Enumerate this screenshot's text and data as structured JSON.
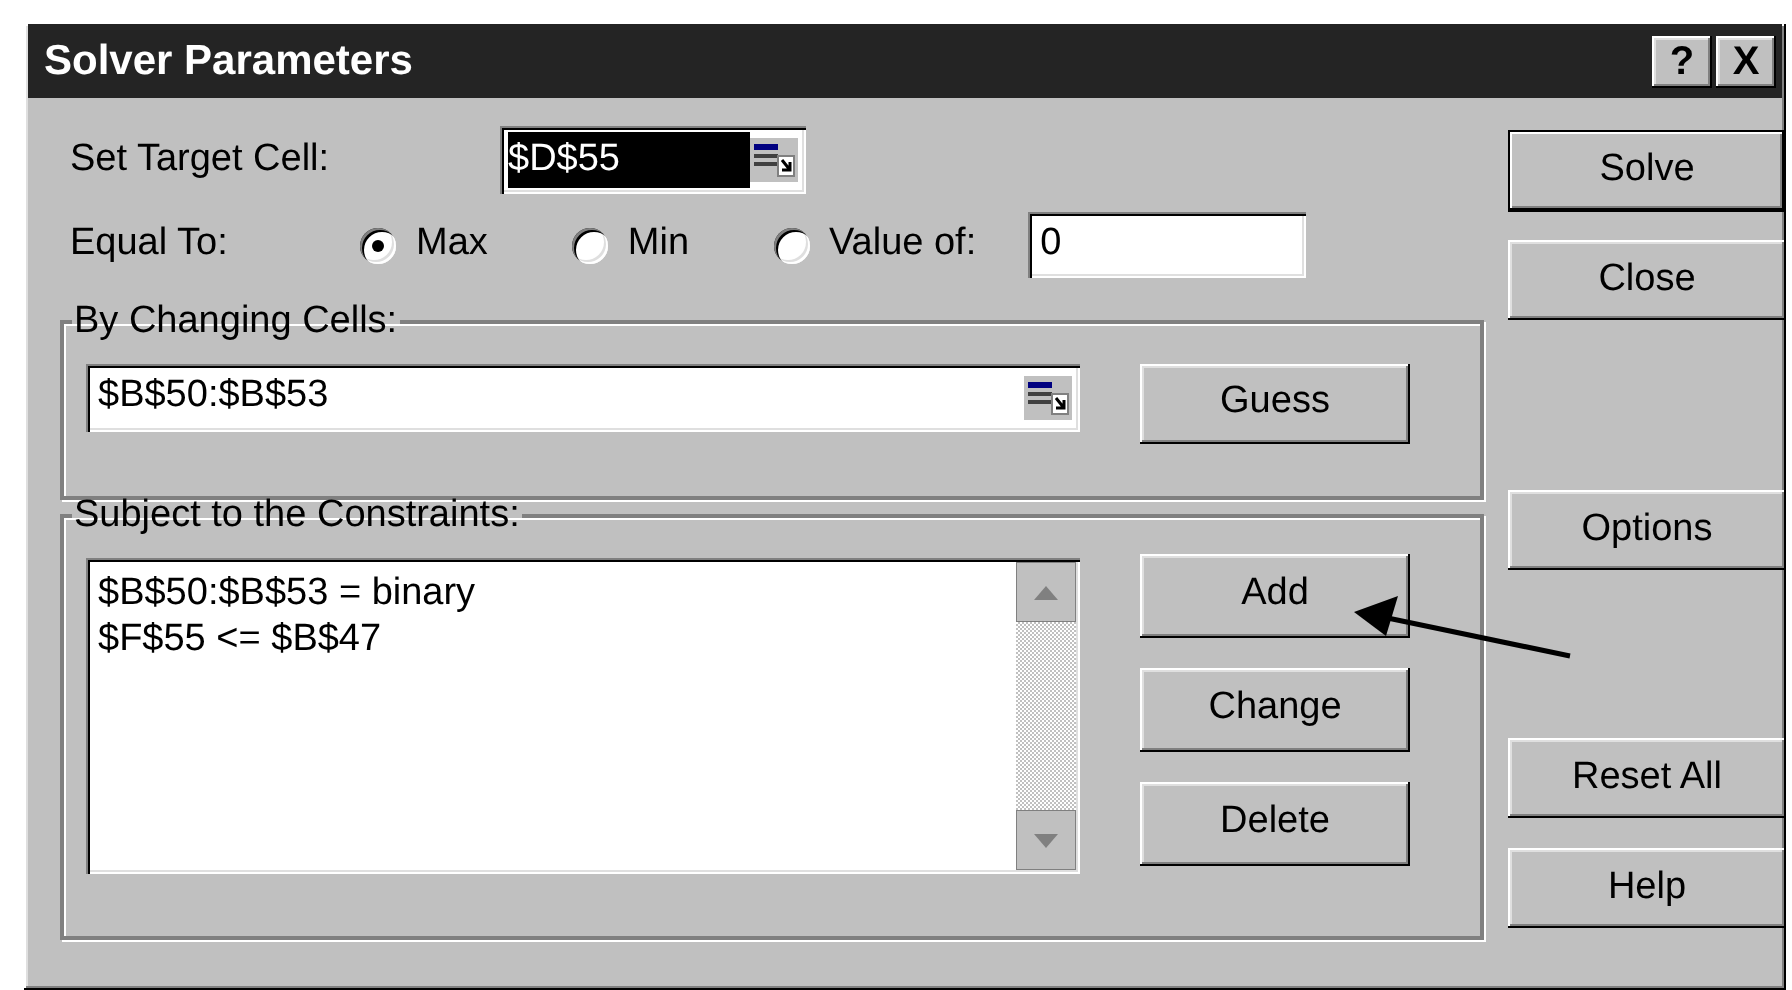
{
  "window": {
    "title": "Solver Parameters",
    "title_buttons": [
      "?",
      "X"
    ]
  },
  "target_cell": {
    "label": "Set Target Cell:",
    "value": "$D$55",
    "selected": true
  },
  "equal_to": {
    "label": "Equal To:",
    "options": [
      {
        "label": "Max",
        "selected": true
      },
      {
        "label": "Min",
        "selected": false
      },
      {
        "label": "Value of:",
        "selected": false
      }
    ],
    "value": "0"
  },
  "changing_cells": {
    "label": "By Changing Cells:",
    "value": "$B$50:$B$53",
    "button": "Guess"
  },
  "constraints": {
    "label": "Subject to the Constraints:",
    "items": [
      "$B$50:$B$53 = binary",
      "$F$55 <= $B$47"
    ],
    "buttons": [
      "Add",
      "Change",
      "Delete"
    ]
  },
  "side_buttons": [
    {
      "label": "Solve",
      "default": true
    },
    {
      "label": "Close",
      "default": false
    },
    {
      "label": "Options",
      "default": false
    },
    {
      "label": "Reset All",
      "default": false
    },
    {
      "label": "Help",
      "default": false
    }
  ]
}
